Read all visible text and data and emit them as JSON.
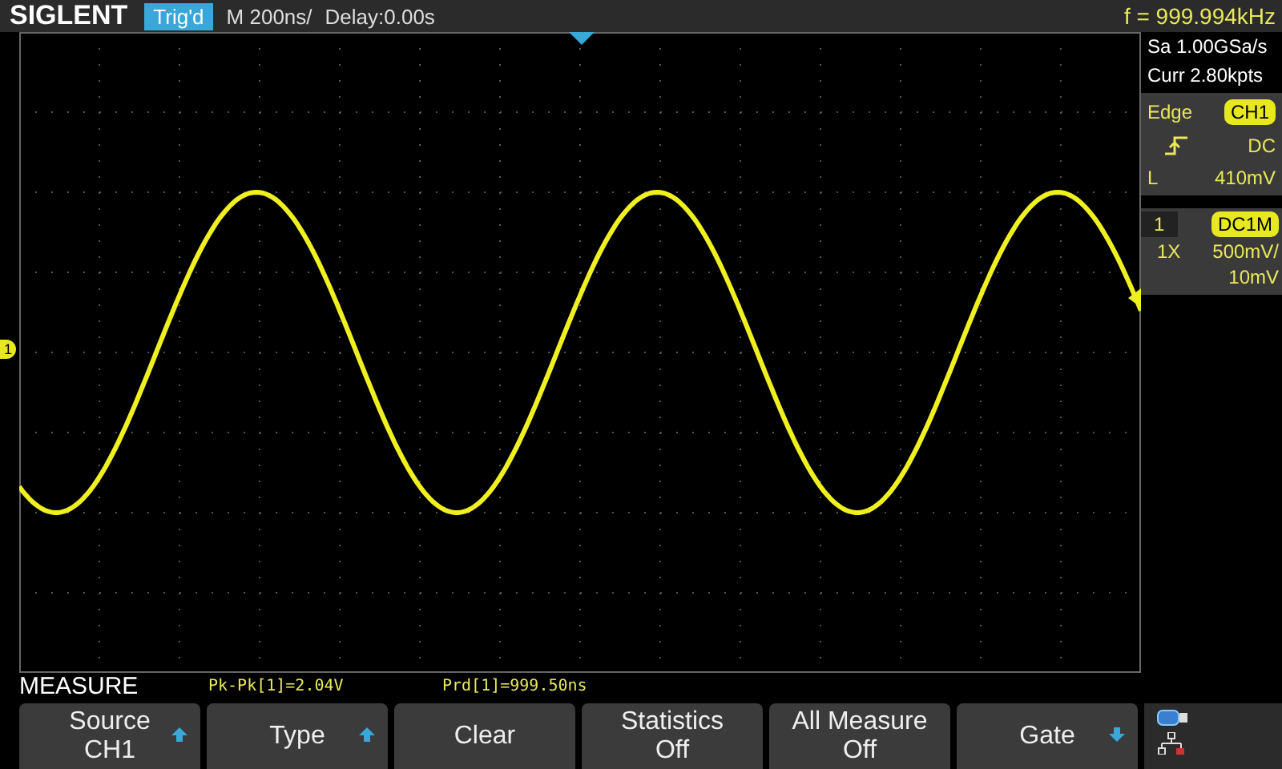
{
  "top_bar": {
    "brand": "SIGLENT",
    "trigger_status": "Trig'd",
    "timebase": "M 200ns/",
    "delay": "Delay:0.00s",
    "frequency": "f = 999.994kHz"
  },
  "acquisition": {
    "sample_rate": "Sa 1.00GSa/s",
    "memory": "Curr 2.80kpts"
  },
  "trigger": {
    "type": "Edge",
    "source": "CH1",
    "coupling": "DC",
    "level_label": "L",
    "level": "410mV"
  },
  "channel": {
    "number": "1",
    "coupling": "DC1M",
    "probe": "1X",
    "scale": "500mV/",
    "offset": "10mV"
  },
  "channel_marker": "1",
  "measure": {
    "title": "MEASURE",
    "readings": [
      "Pk-Pk[1]=2.04V",
      "Prd[1]=999.50ns"
    ]
  },
  "softkeys": [
    {
      "lines": [
        "Source",
        "CH1"
      ],
      "kind": "up"
    },
    {
      "lines": [
        "Type"
      ],
      "kind": "up"
    },
    {
      "lines": [
        "Clear"
      ],
      "kind": "none"
    },
    {
      "lines": [
        "Statistics",
        "Off"
      ],
      "kind": "none"
    },
    {
      "lines": [
        "All Measure",
        "Off"
      ],
      "kind": "none"
    },
    {
      "lines": [
        "Gate"
      ],
      "kind": "down"
    }
  ]
}
